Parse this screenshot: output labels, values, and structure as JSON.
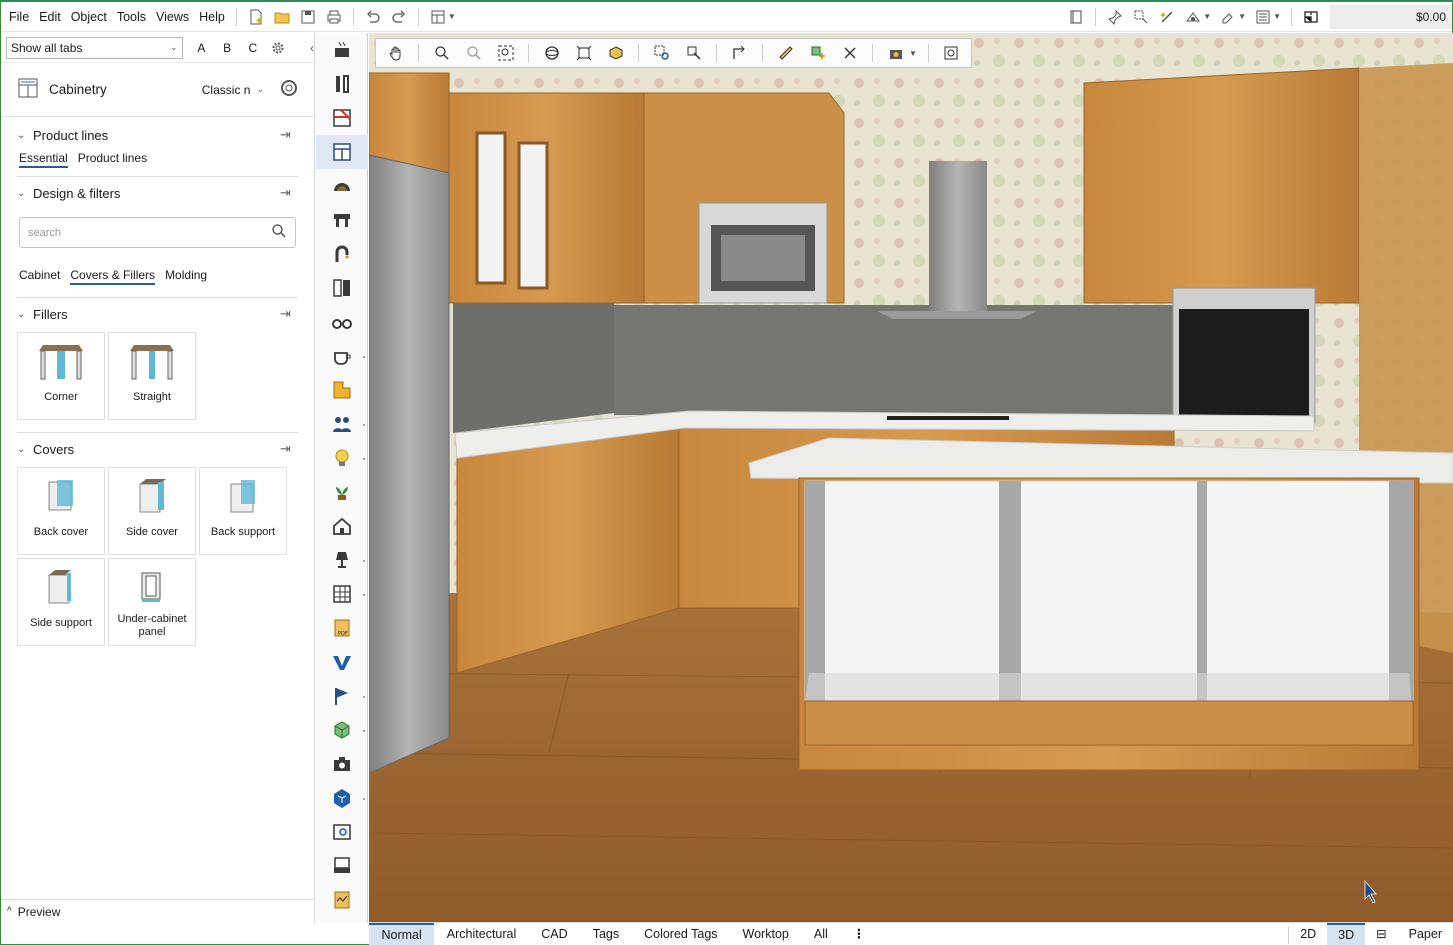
{
  "menu": [
    "File",
    "Edit",
    "Object",
    "Tools",
    "Views",
    "Help"
  ],
  "price": "$0.00",
  "left_panel": {
    "tab_filter": "Show all tabs",
    "letters": [
      "A",
      "B",
      "C"
    ],
    "category": {
      "title": "Cabinetry",
      "variant": "Classic n"
    },
    "product_lines": {
      "title": "Product lines",
      "tabs": [
        "Essential",
        "Product lines"
      ]
    },
    "design_filters": {
      "title": "Design & filters",
      "search_placeholder": "search",
      "tabs": [
        "Cabinet",
        "Covers & Fillers",
        "Molding"
      ]
    },
    "fillers": {
      "title": "Fillers",
      "items": [
        "Corner",
        "Straight"
      ]
    },
    "covers": {
      "title": "Covers",
      "items": [
        "Back cover",
        "Side cover",
        "Back support",
        "Side support",
        "Under-cabinet panel"
      ]
    },
    "preview": "Preview"
  },
  "view_modes": [
    "Normal",
    "Architectural",
    "CAD",
    "Tags",
    "Colored Tags",
    "Worktop",
    "All"
  ],
  "view_right": [
    "2D",
    "3D",
    "Paper"
  ],
  "colors": {
    "accent": "#2a5d9f",
    "wood": "#c98b3e",
    "wall": "#e6e0cf",
    "backsplash": "#6b6b68"
  }
}
